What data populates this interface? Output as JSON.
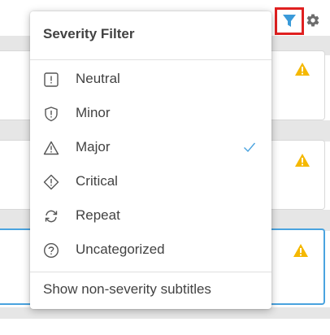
{
  "colors": {
    "accent_blue": "#4aa3df",
    "highlight_red": "#e02020",
    "warning_yellow": "#f5b800",
    "text": "#424242"
  },
  "toolbar": {
    "filter_icon": "filter-icon",
    "settings_icon": "gear-icon"
  },
  "menu": {
    "title": "Severity Filter",
    "items": [
      {
        "label": "Neutral",
        "icon": "square-exclamation-icon",
        "checked": false
      },
      {
        "label": "Minor",
        "icon": "shield-exclamation-icon",
        "checked": false
      },
      {
        "label": "Major",
        "icon": "triangle-exclamation-icon",
        "checked": true
      },
      {
        "label": "Critical",
        "icon": "diamond-exclamation-icon",
        "checked": false
      },
      {
        "label": "Repeat",
        "icon": "repeat-icon",
        "checked": false
      },
      {
        "label": "Uncategorized",
        "icon": "circle-question-icon",
        "checked": false
      }
    ],
    "footer_option": "Show non-severity subtitles"
  }
}
